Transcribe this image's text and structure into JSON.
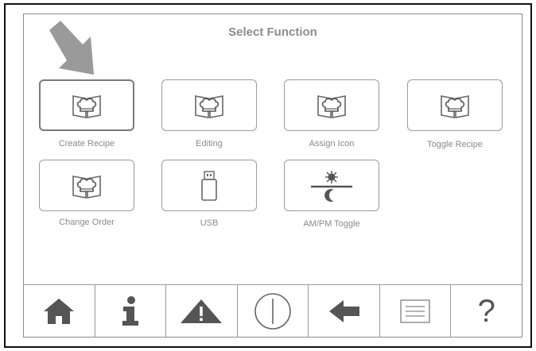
{
  "screen": {
    "title": "Select Function"
  },
  "functions": [
    {
      "label": "Create Recipe",
      "icon": "chef-book-icon"
    },
    {
      "label": "Editing",
      "icon": "chef-book-icon"
    },
    {
      "label": "Assign Icon",
      "icon": "chef-book-icon"
    },
    {
      "label": "Toggle Recipe",
      "icon": "chef-book-icon"
    },
    {
      "label": "Change Order",
      "icon": "chef-book-icon"
    },
    {
      "label": "USB",
      "icon": "usb-drive-icon"
    },
    {
      "label": "AM/PM Toggle",
      "icon": "sun-moon-icon"
    }
  ],
  "navbar": {
    "items": [
      {
        "icon": "home-icon"
      },
      {
        "icon": "info-icon"
      },
      {
        "icon": "warning-icon"
      },
      {
        "icon": "power-icon"
      },
      {
        "icon": "back-arrow-icon"
      },
      {
        "icon": "menu-list-icon"
      },
      {
        "icon": "help-icon",
        "glyph": "?"
      }
    ]
  },
  "colors": {
    "border": "#9a9a9a",
    "icon_gray": "#555555",
    "label_gray": "#8a8a8a"
  }
}
